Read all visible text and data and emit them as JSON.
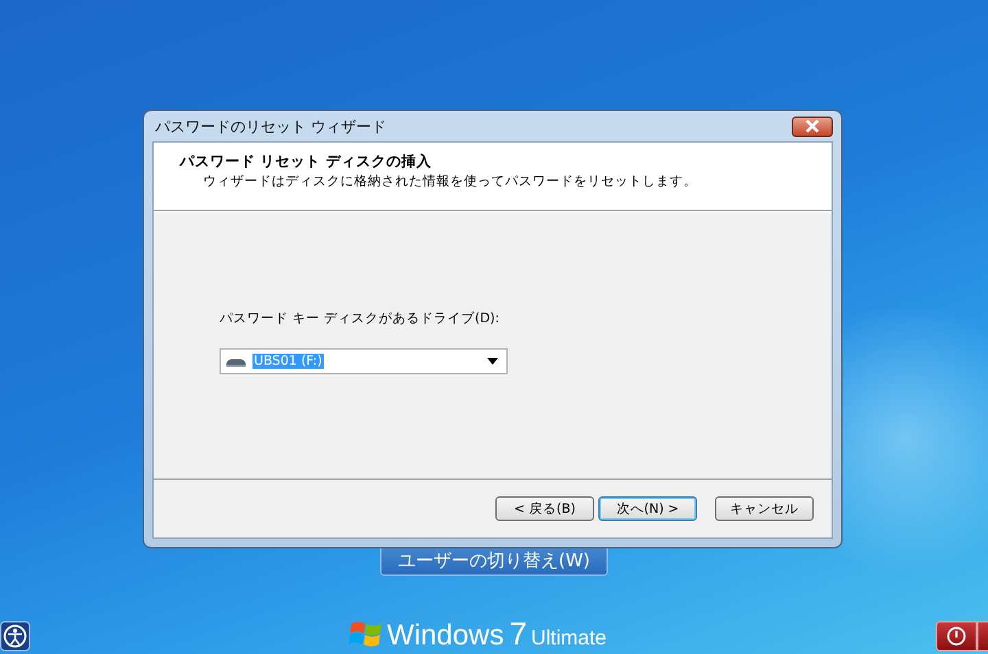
{
  "dialog": {
    "title": "パスワードのリセット ウィザード",
    "header_title": "パスワード リセット ディスクの挿入",
    "header_subtitle": "ウィザードはディスクに格納された情報を使ってパスワードをリセットします。",
    "drive_label": "パスワード キー ディスクがあるドライブ(D):",
    "drive_value": "UBS01 (F:)",
    "buttons": [
      {
        "label": "< 戻る(B)",
        "default": false
      },
      {
        "label": "次へ(N) >",
        "default": true
      },
      {
        "label": "キャンセル",
        "default": false
      }
    ]
  },
  "switch_user_button": "ユーザーの切り替え(W)",
  "branding": {
    "brand": "Windows",
    "version": "7",
    "edition": "Ultimate"
  }
}
